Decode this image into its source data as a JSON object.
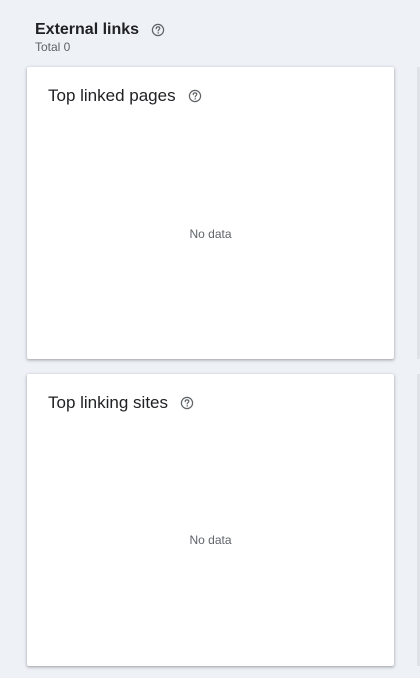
{
  "section": {
    "title": "External links",
    "total": "Total 0"
  },
  "cards": [
    {
      "title": "Top linked pages",
      "empty": "No data"
    },
    {
      "title": "Top linking sites",
      "empty": "No data"
    }
  ],
  "icons": {
    "help": "help-circle-icon"
  },
  "colors": {
    "background": "#eef2f7",
    "card": "#ffffff",
    "text_primary": "#202124",
    "text_secondary": "#5f6368"
  }
}
